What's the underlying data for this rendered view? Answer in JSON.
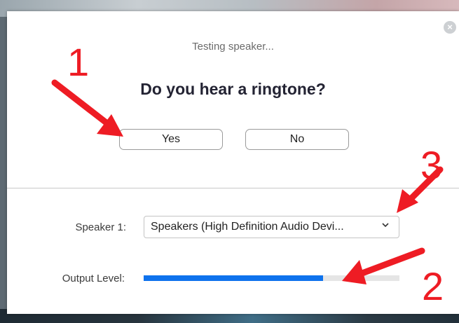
{
  "dialog": {
    "status_text": "Testing speaker...",
    "question": "Do you hear a ringtone?",
    "yes_label": "Yes",
    "no_label": "No",
    "close_icon": "close-icon"
  },
  "speaker": {
    "label": "Speaker 1:",
    "selected": "Speakers (High Definition Audio Devi...",
    "chevron_icon": "chevron-down-icon"
  },
  "output_level": {
    "label": "Output Level:",
    "fraction": 0.7
  },
  "annotations": {
    "marker_1": "1",
    "marker_2": "2",
    "marker_3": "3",
    "color": "#ee1c24"
  },
  "colors": {
    "accent": "#0e72ed"
  }
}
